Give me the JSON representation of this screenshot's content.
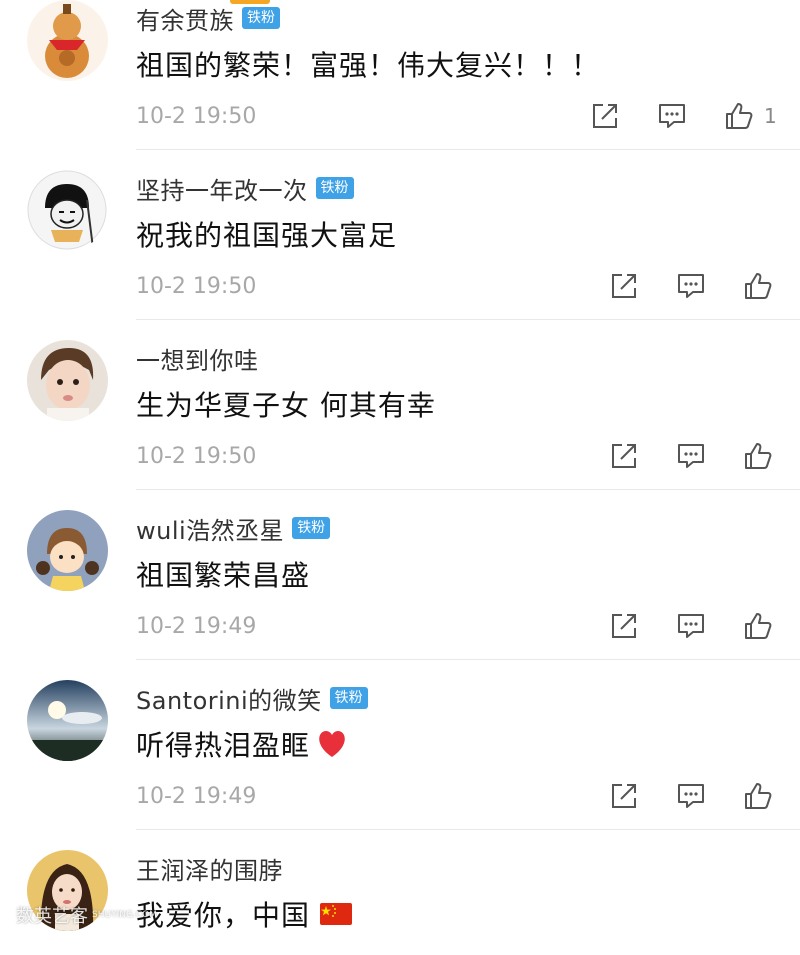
{
  "comments": [
    {
      "username": "有余贯族",
      "badge": "铁粉",
      "text": "祖国的繁荣！富强！伟大复兴！！！",
      "time": "10-2 19:50",
      "likes": "1",
      "avatar": "gourd-avatar"
    },
    {
      "username": "坚持一年改一次",
      "badge": "铁粉",
      "text": "祝我的祖国强大富足",
      "time": "10-2 19:50",
      "likes": "",
      "avatar": "meme-face-avatar"
    },
    {
      "username": "一想到你哇",
      "badge": "",
      "text": "生为华夏子女 何其有幸",
      "time": "10-2 19:50",
      "likes": "",
      "avatar": "baby-avatar"
    },
    {
      "username": "wuli浩然丞星",
      "badge": "铁粉",
      "text": "祖国繁荣昌盛",
      "time": "10-2 19:49",
      "likes": "",
      "avatar": "cartoon-girl-avatar"
    },
    {
      "username": "Santorini的微笑",
      "badge": "铁粉",
      "text": "听得热泪盈眶",
      "time": "10-2 19:49",
      "likes": "",
      "avatar": "sky-avatar"
    },
    {
      "username": "王润泽的围脖",
      "badge": "",
      "text": "我爱你，中国",
      "time": "",
      "likes": "",
      "avatar": "woman-avatar"
    }
  ],
  "icons": {
    "share": "share-icon",
    "reply": "comment-icon",
    "like": "thumbs-up-icon"
  },
  "emoji": {
    "heart": "red-heart",
    "flag": "china-flag"
  },
  "watermark": {
    "main": "数英艺客",
    "sub": "SHUYING.COM"
  },
  "colors": {
    "badge": "#3fa2e6",
    "time": "#a8a8a8",
    "divider": "#e9e9e9"
  }
}
